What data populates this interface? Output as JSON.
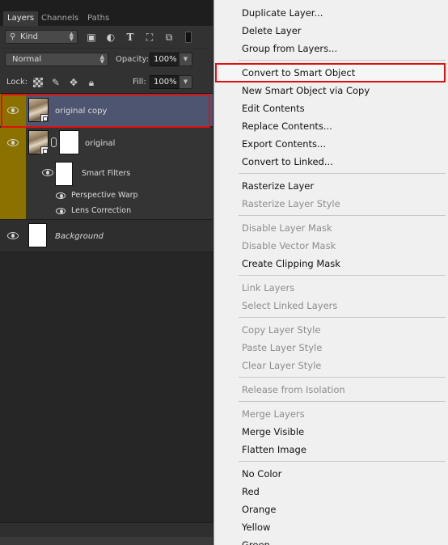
{
  "panel": {
    "tabs": [
      "Layers",
      "Channels",
      "Paths"
    ],
    "filter": {
      "kind_label": "Kind",
      "icons": [
        "image-filter-icon",
        "adjustment-filter-icon",
        "type-filter-icon",
        "shape-filter-icon",
        "smart-object-filter-icon"
      ]
    },
    "blend_mode": "Normal",
    "opacity_label": "Opacity:",
    "opacity_value": "100%",
    "lock_label": "Lock:",
    "fill_label": "Fill:",
    "fill_value": "100%",
    "layers": [
      {
        "name": "original copy",
        "selected": true,
        "smart_object": true
      },
      {
        "name": "original",
        "smart_object": true,
        "has_mask": true,
        "smart_filters_label": "Smart Filters",
        "filters": [
          "Perspective Warp",
          "Lens Correction"
        ]
      },
      {
        "name": "Background"
      }
    ]
  },
  "menu": {
    "groups": [
      [
        {
          "label": "Duplicate Layer..."
        },
        {
          "label": "Delete Layer"
        },
        {
          "label": "Group from Layers..."
        }
      ],
      [
        {
          "label": "Convert to Smart Object",
          "highlighted": true
        },
        {
          "label": "New Smart Object via Copy"
        },
        {
          "label": "Edit Contents"
        },
        {
          "label": "Replace Contents..."
        },
        {
          "label": "Export Contents..."
        },
        {
          "label": "Convert to Linked..."
        }
      ],
      [
        {
          "label": "Rasterize Layer"
        },
        {
          "label": "Rasterize Layer Style",
          "disabled": true
        }
      ],
      [
        {
          "label": "Disable Layer Mask",
          "disabled": true
        },
        {
          "label": "Disable Vector Mask",
          "disabled": true
        },
        {
          "label": "Create Clipping Mask"
        }
      ],
      [
        {
          "label": "Link Layers",
          "disabled": true
        },
        {
          "label": "Select Linked Layers",
          "disabled": true
        }
      ],
      [
        {
          "label": "Copy Layer Style",
          "disabled": true
        },
        {
          "label": "Paste Layer Style",
          "disabled": true
        },
        {
          "label": "Clear Layer Style",
          "disabled": true
        }
      ],
      [
        {
          "label": "Release from Isolation",
          "disabled": true
        }
      ],
      [
        {
          "label": "Merge Layers",
          "disabled": true
        },
        {
          "label": "Merge Visible"
        },
        {
          "label": "Flatten Image"
        }
      ],
      [
        {
          "label": "No Color"
        },
        {
          "label": "Red"
        },
        {
          "label": "Orange"
        },
        {
          "label": "Yellow"
        },
        {
          "label": "Green"
        }
      ]
    ]
  },
  "colors": {
    "highlight_outline": "#e01010",
    "visibility_column": "#8b7100",
    "selected_layer": "#4e5570",
    "menu_bg": "#f0f0f0"
  }
}
